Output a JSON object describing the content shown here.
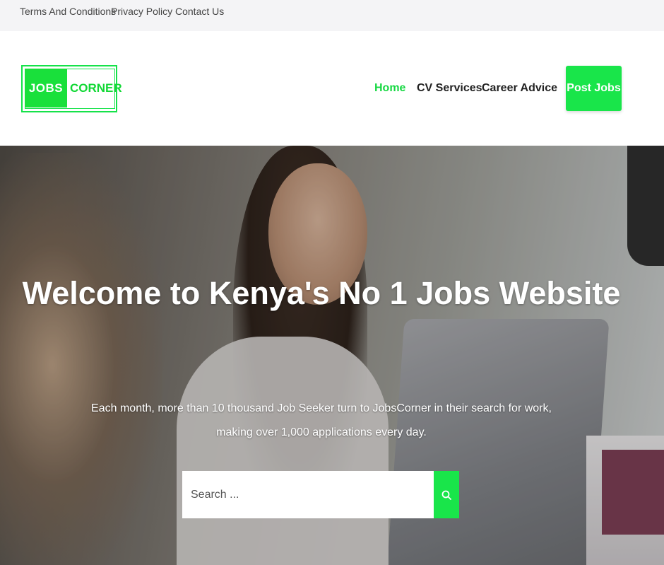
{
  "topbar": {
    "links": [
      "Terms And Conditions",
      "Privacy Policy",
      "Contact Us"
    ]
  },
  "header": {
    "logo": {
      "left_text": "JOBS",
      "right_text": "CORNER"
    },
    "nav": [
      "Home",
      "CV Services",
      "Career Advice"
    ],
    "post_button": "Post Jobs"
  },
  "hero": {
    "title": "Welcome to Kenya's No 1 Jobs Website",
    "subtitle_line1": "Each month, more than 10 thousand Job Seeker turn to JobsCorner in their search for work,",
    "subtitle_line2": "making over 1,000 applications every day.",
    "search": {
      "placeholder": "Search ...",
      "icon": "search-icon"
    }
  },
  "colors": {
    "accent": "#19e54a",
    "nav_active": "#17d843"
  }
}
